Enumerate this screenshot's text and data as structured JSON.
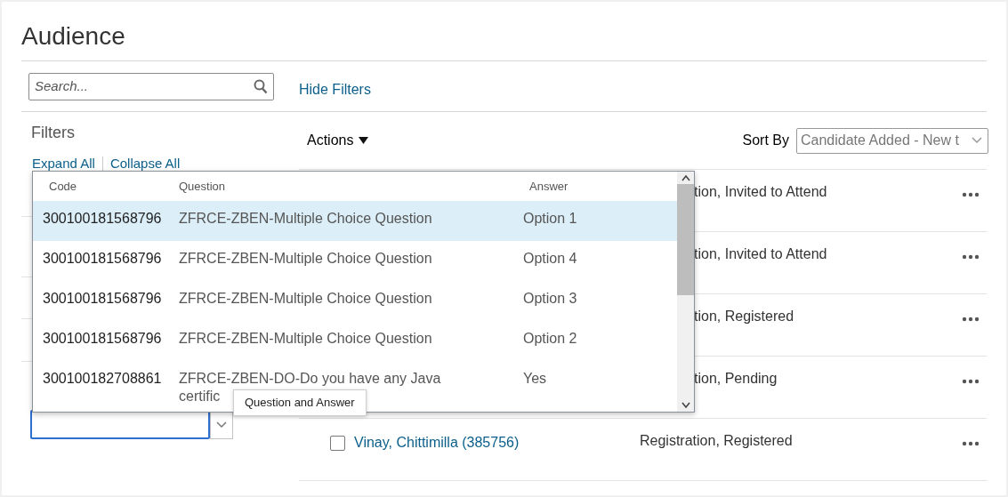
{
  "page": {
    "title": "Audience"
  },
  "search": {
    "placeholder": "Search..."
  },
  "hide_filters": "Hide Filters",
  "filters": {
    "title": "Filters",
    "expand_all": "Expand All",
    "collapse_all": "Collapse All"
  },
  "actions": "Actions",
  "sort": {
    "label": "Sort By",
    "value": "Candidate Added - New t"
  },
  "rows": [
    {
      "status": "tion, Invited to Attend"
    },
    {
      "status": "tion, Invited to Attend"
    },
    {
      "status": "tion, Registered"
    },
    {
      "status": "tion, Pending"
    },
    {
      "name": "Vinay, Chittimilla (385756)",
      "checked": false,
      "status": "Registration, Registered"
    }
  ],
  "popup": {
    "columns": [
      "Code",
      "Question",
      "Answer"
    ],
    "rows": [
      {
        "code": "300100181568796",
        "question": "ZFRCE-ZBEN-Multiple Choice Question",
        "answer": "Option 1",
        "selected": true
      },
      {
        "code": "300100181568796",
        "question": "ZFRCE-ZBEN-Multiple Choice Question",
        "answer": "Option 4",
        "selected": false
      },
      {
        "code": "300100181568796",
        "question": "ZFRCE-ZBEN-Multiple Choice Question",
        "answer": "Option 3",
        "selected": false
      },
      {
        "code": "300100181568796",
        "question": "ZFRCE-ZBEN-Multiple Choice Question",
        "answer": "Option 2",
        "selected": false
      },
      {
        "code": "300100182708861",
        "question": "ZFRCE-ZBEN-DO-Do you have any Java certific",
        "answer": "Yes",
        "selected": false
      }
    ]
  },
  "tooltip": "Question and Answer"
}
